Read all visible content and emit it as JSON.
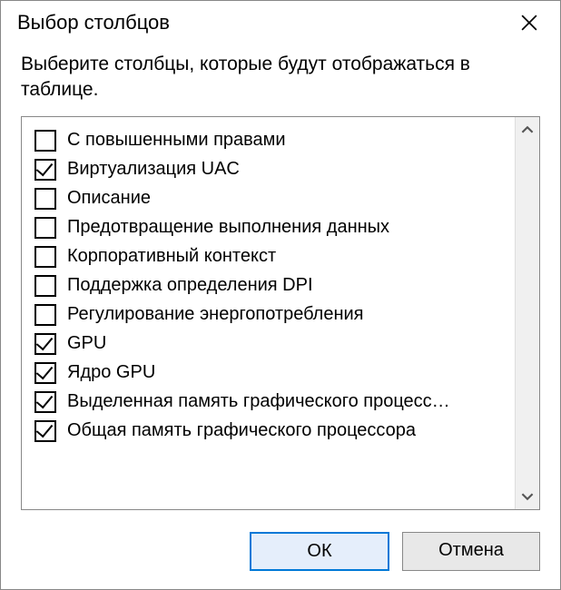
{
  "window": {
    "title": "Выбор столбцов",
    "instructions": "Выберите столбцы, которые будут отображаться в таблице."
  },
  "columns": [
    {
      "label": "С повышенными правами",
      "checked": false
    },
    {
      "label": "Виртуализация UAC",
      "checked": true
    },
    {
      "label": "Описание",
      "checked": false
    },
    {
      "label": "Предотвращение выполнения данных",
      "checked": false
    },
    {
      "label": "Корпоративный контекст",
      "checked": false
    },
    {
      "label": "Поддержка определения DPI",
      "checked": false
    },
    {
      "label": "Регулирование энергопотребления",
      "checked": false
    },
    {
      "label": "GPU",
      "checked": true
    },
    {
      "label": "Ядро GPU",
      "checked": true
    },
    {
      "label": "Выделенная память графического процесс…",
      "checked": true
    },
    {
      "label": "Общая память графического процессора",
      "checked": true
    }
  ],
  "buttons": {
    "ok": "ОК",
    "cancel": "Отмена"
  }
}
